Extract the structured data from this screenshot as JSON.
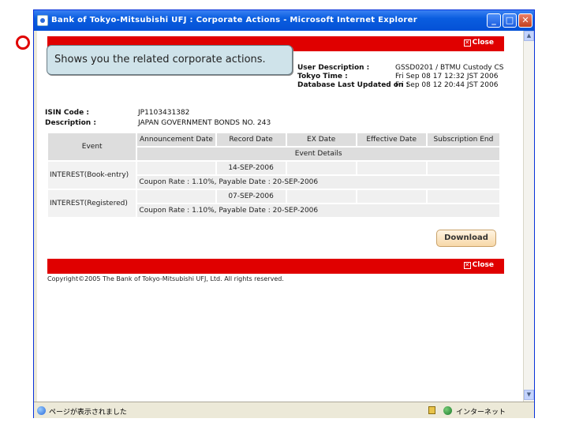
{
  "window": {
    "title": "Bank of Tokyo-Mitsubishi UFJ : Corporate Actions - Microsoft Internet Explorer",
    "minimize": "_",
    "maximize": "□",
    "close": "✕"
  },
  "tooltip": "Shows you the related corporate actions.",
  "header": {
    "close_label": "Close",
    "user_description_label": "User Description :",
    "user_description_value": "GSSD0201 / BTMU Custody CS",
    "tokyo_time_label": "Tokyo Time :",
    "tokyo_time_value": "Fri Sep 08 17 12:32 JST 2006",
    "db_updated_label": "Database Last Updated on :",
    "db_updated_value": "Fri Sep 08 12 20:44 JST 2006"
  },
  "security": {
    "isin_label": "ISIN Code :",
    "isin_value": "JP1103431382",
    "description_label": "Description :",
    "description_value": "JAPAN GOVERNMENT BONDS NO. 243"
  },
  "table": {
    "headers": [
      "Event",
      "Announcement Date",
      "Record Date",
      "EX Date",
      "Effective Date",
      "Subscription End"
    ],
    "event_details_header": "Event Details",
    "rows": [
      {
        "event": "INTEREST(Book-entry)",
        "record_date": "14-SEP-2006",
        "details": "Coupon Rate : 1.10%, Payable Date : 20-SEP-2006"
      },
      {
        "event": "INTEREST(Registered)",
        "record_date": "07-SEP-2006",
        "details": "Coupon Rate : 1.10%, Payable Date : 20-SEP-2006"
      }
    ]
  },
  "download_label": "Download",
  "footer": {
    "close_label": "Close",
    "copyright": "Copyright©2005 The Bank of Tokyo-Mitsubishi UFJ, Ltd. All rights reserved."
  },
  "statusbar": {
    "status_text": "ページが表示されました",
    "zone_text": "インターネット"
  },
  "colors": {
    "brand_red": "#e00000",
    "titlebar_blue": "#0a5ddf",
    "tooltip_bg": "#cfe3ea"
  }
}
